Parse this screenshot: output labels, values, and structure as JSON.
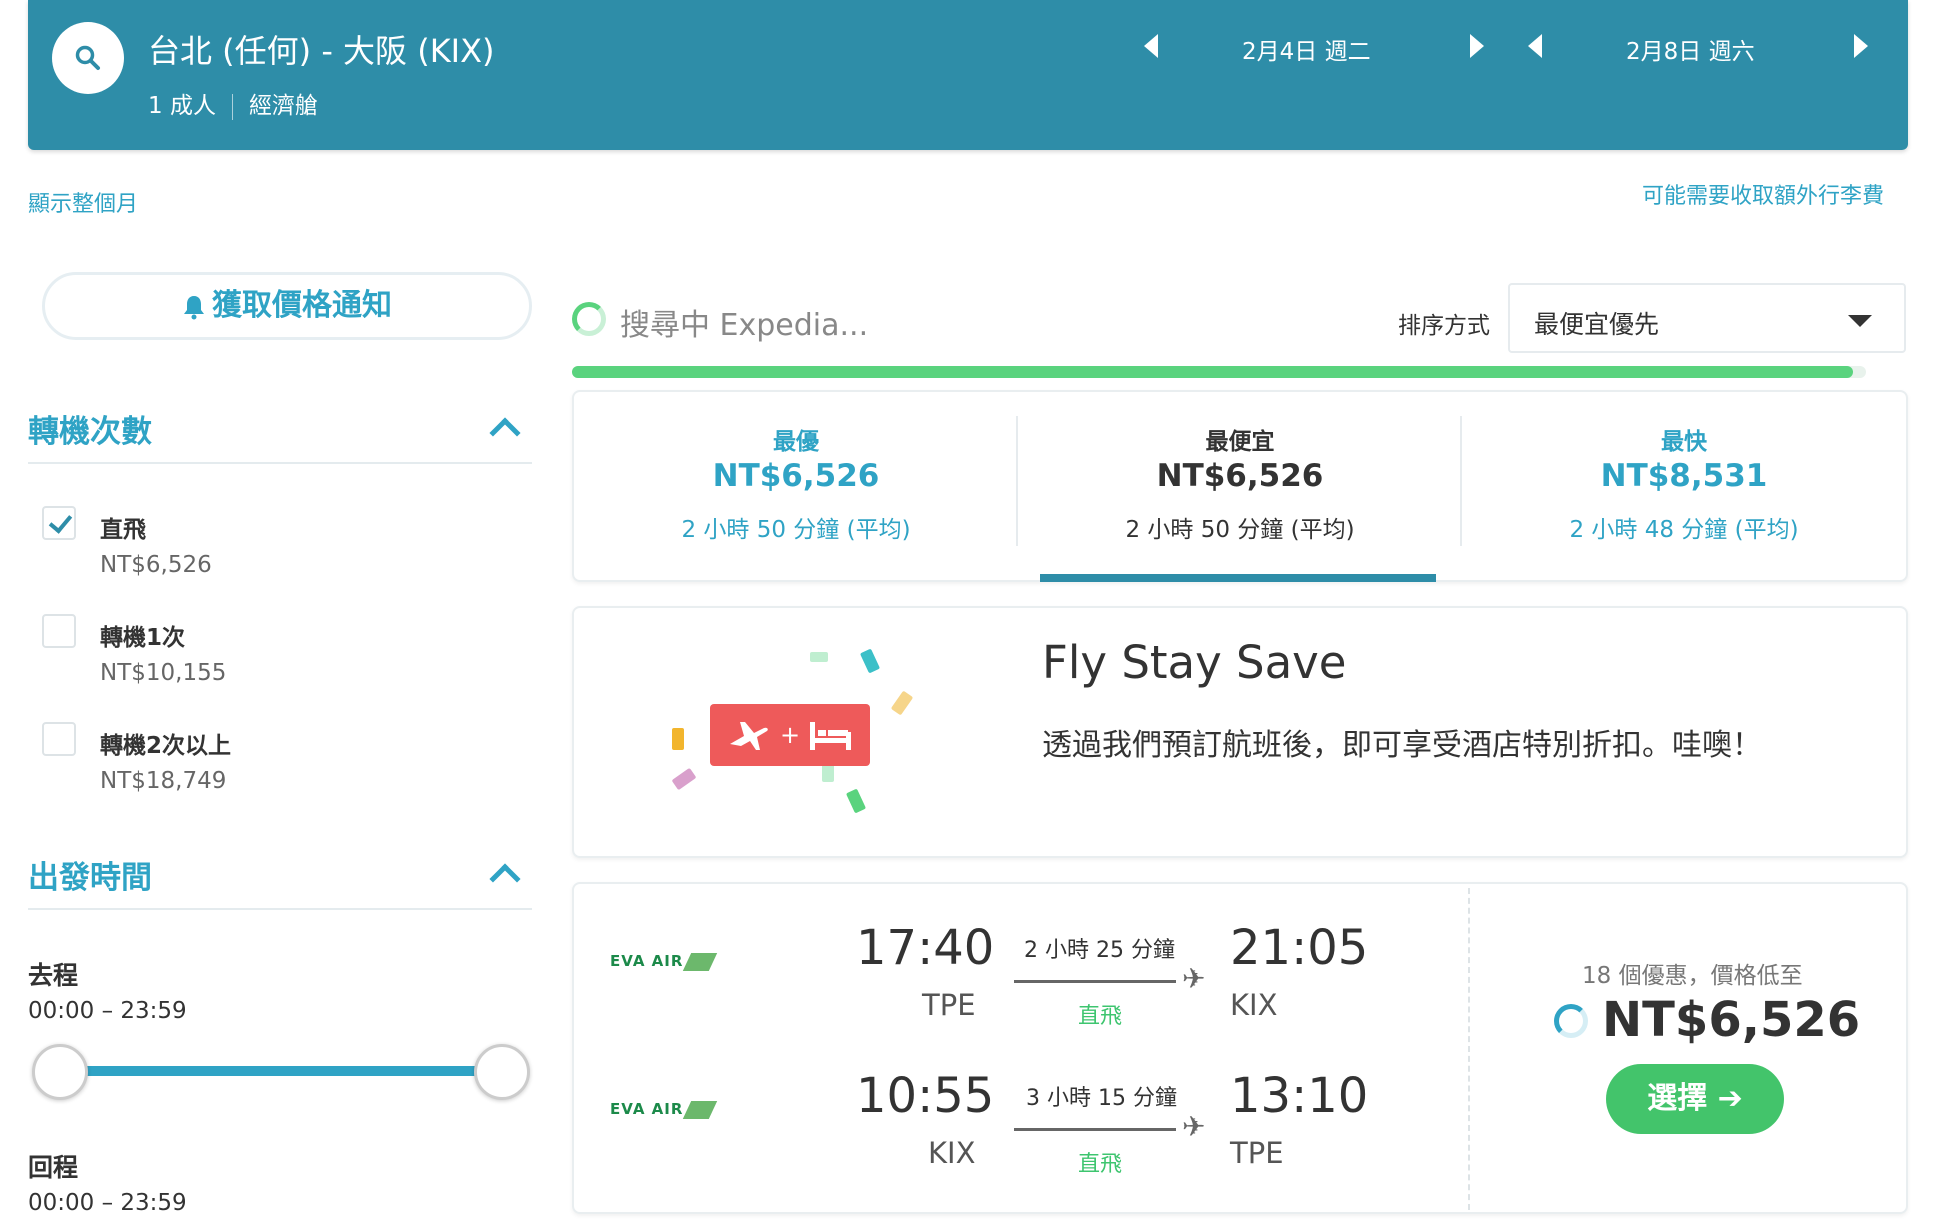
{
  "header": {
    "route": "台北 (任何) - 大阪 (KIX)",
    "passengers": "1 成人",
    "cabin": "經濟艙",
    "depart_date": "2月4日 週二",
    "return_date": "2月8日 週六"
  },
  "links": {
    "show_month": "顯示整個月",
    "baggage_fee": "可能需要收取額外行李費"
  },
  "sidebar": {
    "price_alert": "獲取價格通知",
    "stops_title": "轉機次數",
    "stops": [
      {
        "label": "直飛",
        "price": "NT$6,526",
        "checked": true
      },
      {
        "label": "轉機1次",
        "price": "NT$10,155",
        "checked": false
      },
      {
        "label": "轉機2次以上",
        "price": "NT$18,749",
        "checked": false
      }
    ],
    "times_title": "出發時間",
    "outbound_label": "去程",
    "outbound_range": "00:00 – 23:59",
    "return_label": "回程",
    "return_range": "00:00 – 23:59"
  },
  "main": {
    "searching": "搜尋中 Expedia...",
    "progress": 0.99,
    "sort_label": "排序方式",
    "sort_value": "最便宜優先",
    "tabs": [
      {
        "title": "最優",
        "price": "NT$6,526",
        "duration": "2 小時 50 分鐘 (平均)"
      },
      {
        "title": "最便宜",
        "price": "NT$6,526",
        "duration": "2 小時 50 分鐘 (平均)"
      },
      {
        "title": "最快",
        "price": "NT$8,531",
        "duration": "2 小時 48 分鐘 (平均)"
      }
    ],
    "promo": {
      "title": "Fly Stay Save",
      "text": "透過我們預訂航班後，即可享受酒店特別折扣。哇噢！"
    },
    "result": {
      "airline": "EVA AIR",
      "legs": [
        {
          "depart_time": "17:40",
          "depart_code": "TPE",
          "duration": "2 小時 25 分鐘",
          "stops": "直飛",
          "arrive_time": "21:05",
          "arrive_code": "KIX"
        },
        {
          "depart_time": "10:55",
          "depart_code": "KIX",
          "duration": "3 小時 15 分鐘",
          "stops": "直飛",
          "arrive_time": "13:10",
          "arrive_code": "TPE"
        }
      ],
      "deals": "18 個優惠，價格低至",
      "price": "NT$6,526",
      "select_label": "選擇 ➔"
    }
  },
  "colors": {
    "header_bg": "#2e8da8",
    "accent_blue": "#2fa3c5",
    "green": "#43c46b",
    "promo_red": "#ee5a5a"
  }
}
